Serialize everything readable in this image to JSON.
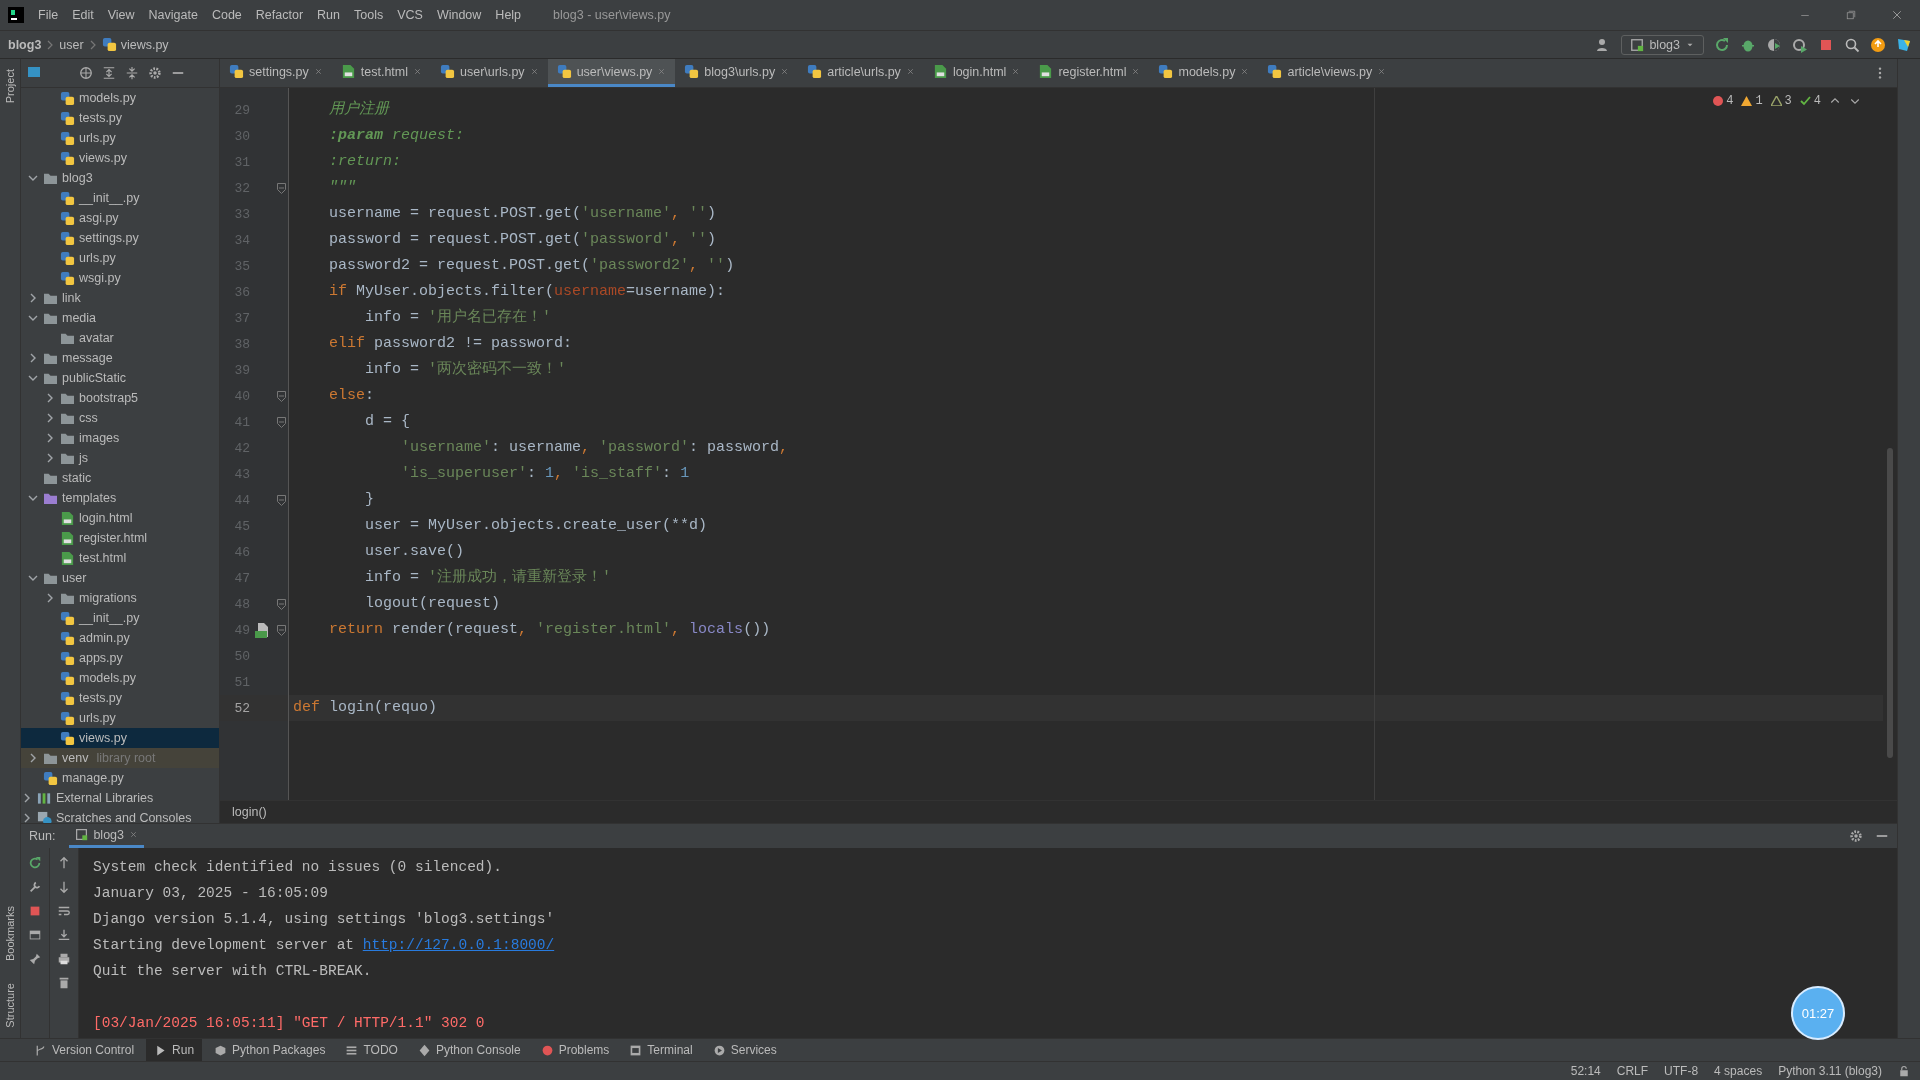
{
  "window": {
    "title": "blog3 - user\\views.py",
    "menu": [
      "File",
      "Edit",
      "View",
      "Navigate",
      "Code",
      "Refactor",
      "Run",
      "Tools",
      "VCS",
      "Window",
      "Help"
    ]
  },
  "breadcrumbs": [
    "blog3",
    "user",
    "views.py"
  ],
  "run_config": {
    "label": "blog3"
  },
  "left_strip": {
    "top": [
      "Project"
    ],
    "bottom": [
      "Bookmarks",
      "Structure"
    ]
  },
  "project_tree": [
    {
      "children": [
        {
          "children": [
            {
              "label": "models.py",
              "kind": "py",
              "selected": false
            },
            {
              "label": "tests.py",
              "kind": "py",
              "selected": false
            },
            {
              "label": "urls.py",
              "kind": "py",
              "selected": false
            },
            {
              "label": "views.py",
              "kind": "py",
              "selected": false
            }
          ]
        },
        {
          "label": "blog3",
          "kind": "folder",
          "expanded": true,
          "selected": false,
          "children": [
            {
              "label": "__init__.py",
              "kind": "py",
              "selected": false
            },
            {
              "label": "asgi.py",
              "kind": "py",
              "selected": false
            },
            {
              "label": "settings.py",
              "kind": "py",
              "selected": false
            },
            {
              "label": "urls.py",
              "kind": "py",
              "selected": false
            },
            {
              "label": "wsgi.py",
              "kind": "py",
              "selected": false
            }
          ]
        },
        {
          "label": "link",
          "kind": "folder",
          "expanded": false,
          "selected": false
        },
        {
          "label": "media",
          "kind": "folder",
          "expanded": true,
          "selected": false,
          "children": [
            {
              "label": "avatar",
              "kind": "folder",
              "selected": false
            }
          ]
        },
        {
          "label": "message",
          "kind": "folder",
          "expanded": false,
          "selected": false
        },
        {
          "label": "publicStatic",
          "kind": "folder",
          "expanded": true,
          "selected": false,
          "children": [
            {
              "label": "bootstrap5",
              "kind": "folder",
              "expanded": false,
              "selected": false
            },
            {
              "label": "css",
              "kind": "folder",
              "expanded": false,
              "selected": false
            },
            {
              "label": "images",
              "kind": "folder",
              "expanded": false,
              "selected": false
            },
            {
              "label": "js",
              "kind": "folder",
              "expanded": false,
              "selected": false
            }
          ]
        },
        {
          "label": "static",
          "kind": "folder",
          "selected": false
        },
        {
          "label": "templates",
          "kind": "template-folder",
          "expanded": true,
          "selected": false,
          "children": [
            {
              "label": "login.html",
              "kind": "html",
              "selected": false
            },
            {
              "label": "register.html",
              "kind": "html",
              "selected": false
            },
            {
              "label": "test.html",
              "kind": "html",
              "selected": false
            }
          ]
        },
        {
          "label": "user",
          "kind": "folder",
          "expanded": true,
          "selected": false,
          "children": [
            {
              "label": "migrations",
              "kind": "folder",
              "expanded": false,
              "selected": false
            },
            {
              "label": "__init__.py",
              "kind": "py",
              "selected": false
            },
            {
              "label": "admin.py",
              "kind": "py",
              "selected": false
            },
            {
              "label": "apps.py",
              "kind": "py",
              "selected": false
            },
            {
              "label": "models.py",
              "kind": "py",
              "selected": false
            },
            {
              "label": "tests.py",
              "kind": "py",
              "selected": false
            },
            {
              "label": "urls.py",
              "kind": "py",
              "selected": false
            },
            {
              "label": "views.py",
              "kind": "py",
              "selected": true
            }
          ]
        },
        {
          "label": "venv",
          "note": "library root",
          "kind": "library-folder",
          "expanded": false,
          "selected": false
        },
        {
          "label": "manage.py",
          "kind": "py",
          "selected": false
        }
      ]
    },
    {
      "label": "External Libraries",
      "kind": "libraries",
      "expanded": false,
      "selected": false
    },
    {
      "label": "Scratches and Consoles",
      "kind": "scratches",
      "expanded": false,
      "selected": false
    }
  ],
  "editor_tabs": [
    {
      "label": "settings.py",
      "kind": "py",
      "selected": false
    },
    {
      "label": "test.html",
      "kind": "html",
      "selected": false
    },
    {
      "label": "user\\urls.py",
      "kind": "py",
      "selected": false
    },
    {
      "label": "user\\views.py",
      "kind": "py",
      "selected": true
    },
    {
      "label": "blog3\\urls.py",
      "kind": "py",
      "selected": false
    },
    {
      "label": "article\\urls.py",
      "kind": "py",
      "selected": false
    },
    {
      "label": "login.html",
      "kind": "html",
      "selected": false
    },
    {
      "label": "register.html",
      "kind": "html",
      "selected": false
    },
    {
      "label": "models.py",
      "kind": "py",
      "selected": false
    },
    {
      "label": "article\\views.py",
      "kind": "py",
      "selected": false
    }
  ],
  "inspections": [
    {
      "kind": "error",
      "count": "4"
    },
    {
      "kind": "warning",
      "count": "1"
    },
    {
      "kind": "weak",
      "count": "3"
    },
    {
      "kind": "typo",
      "count": "4"
    }
  ],
  "code_lines": [
    {
      "number": "29",
      "fold": false,
      "current": false,
      "gutter_icon": false,
      "tokens": [
        {
          "text": "    用户注册",
          "kind": "doc"
        }
      ]
    },
    {
      "number": "30",
      "fold": false,
      "current": false,
      "gutter_icon": false,
      "tokens": [
        {
          "text": "    :param",
          "kind": "doctag"
        },
        {
          "text": " request:",
          "kind": "doc"
        }
      ]
    },
    {
      "number": "31",
      "fold": false,
      "current": false,
      "gutter_icon": false,
      "tokens": [
        {
          "text": "    :return:",
          "kind": "doc"
        }
      ]
    },
    {
      "number": "32",
      "fold": true,
      "current": false,
      "gutter_icon": false,
      "tokens": [
        {
          "text": "    \"\"\"",
          "kind": "doc"
        }
      ]
    },
    {
      "number": "33",
      "fold": false,
      "current": false,
      "gutter_icon": false,
      "tokens": [
        {
          "text": "    username = request.POST.get(",
          "kind": "plain"
        },
        {
          "text": "'username'",
          "kind": "str"
        },
        {
          "text": ", ",
          "kind": "kw"
        },
        {
          "text": "''",
          "kind": "str"
        },
        {
          "text": ")",
          "kind": "plain"
        }
      ]
    },
    {
      "number": "34",
      "fold": false,
      "current": false,
      "gutter_icon": false,
      "tokens": [
        {
          "text": "    password = request.POST.get(",
          "kind": "plain"
        },
        {
          "text": "'password'",
          "kind": "str"
        },
        {
          "text": ", ",
          "kind": "kw"
        },
        {
          "text": "''",
          "kind": "str"
        },
        {
          "text": ")",
          "kind": "plain"
        }
      ]
    },
    {
      "number": "35",
      "fold": false,
      "current": false,
      "gutter_icon": false,
      "tokens": [
        {
          "text": "    password2 = request.POST.get(",
          "kind": "plain"
        },
        {
          "text": "'password2'",
          "kind": "str"
        },
        {
          "text": ", ",
          "kind": "kw"
        },
        {
          "text": "''",
          "kind": "str"
        },
        {
          "text": ")",
          "kind": "plain"
        }
      ]
    },
    {
      "number": "36",
      "fold": false,
      "current": false,
      "gutter_icon": false,
      "tokens": [
        {
          "text": "    if",
          "kind": "kw"
        },
        {
          "text": " MyUser.objects.filter(",
          "kind": "plain"
        },
        {
          "text": "username",
          "kind": "param"
        },
        {
          "text": "=username):",
          "kind": "plain"
        }
      ]
    },
    {
      "number": "37",
      "fold": false,
      "current": false,
      "gutter_icon": false,
      "tokens": [
        {
          "text": "        info = ",
          "kind": "plain"
        },
        {
          "text": "'用户名已存在！'",
          "kind": "str"
        }
      ]
    },
    {
      "number": "38",
      "fold": false,
      "current": false,
      "gutter_icon": false,
      "tokens": [
        {
          "text": "    elif",
          "kind": "kw"
        },
        {
          "text": " password2 != password:",
          "kind": "plain"
        }
      ]
    },
    {
      "number": "39",
      "fold": false,
      "current": false,
      "gutter_icon": false,
      "tokens": [
        {
          "text": "        info = ",
          "kind": "plain"
        },
        {
          "text": "'两次密码不一致！'",
          "kind": "str"
        }
      ]
    },
    {
      "number": "40",
      "fold": true,
      "current": false,
      "gutter_icon": false,
      "tokens": [
        {
          "text": "    else",
          "kind": "kw"
        },
        {
          "text": ":",
          "kind": "plain"
        }
      ]
    },
    {
      "number": "41",
      "fold": true,
      "current": false,
      "gutter_icon": false,
      "tokens": [
        {
          "text": "        d = {",
          "kind": "plain"
        }
      ]
    },
    {
      "number": "42",
      "fold": false,
      "current": false,
      "gutter_icon": false,
      "tokens": [
        {
          "text": "            'username'",
          "kind": "str"
        },
        {
          "text": ": username",
          "kind": "plain"
        },
        {
          "text": ", ",
          "kind": "kw"
        },
        {
          "text": "'password'",
          "kind": "str"
        },
        {
          "text": ": password",
          "kind": "plain"
        },
        {
          "text": ",",
          "kind": "kw"
        }
      ]
    },
    {
      "number": "43",
      "fold": false,
      "current": false,
      "gutter_icon": false,
      "tokens": [
        {
          "text": "            'is_superuser'",
          "kind": "str"
        },
        {
          "text": ": ",
          "kind": "plain"
        },
        {
          "text": "1",
          "kind": "num"
        },
        {
          "text": ", ",
          "kind": "kw"
        },
        {
          "text": "'is_staff'",
          "kind": "str"
        },
        {
          "text": ": ",
          "kind": "plain"
        },
        {
          "text": "1",
          "kind": "num"
        }
      ]
    },
    {
      "number": "44",
      "fold": true,
      "current": false,
      "gutter_icon": false,
      "tokens": [
        {
          "text": "        }",
          "kind": "plain"
        }
      ]
    },
    {
      "number": "45",
      "fold": false,
      "current": false,
      "gutter_icon": false,
      "tokens": [
        {
          "text": "        user = MyUser.objects.create_user(**d)",
          "kind": "plain"
        }
      ]
    },
    {
      "number": "46",
      "fold": false,
      "current": false,
      "gutter_icon": false,
      "tokens": [
        {
          "text": "        user.save()",
          "kind": "plain"
        }
      ]
    },
    {
      "number": "47",
      "fold": false,
      "current": false,
      "gutter_icon": false,
      "tokens": [
        {
          "text": "        info = ",
          "kind": "plain"
        },
        {
          "text": "'注册成功，请重新登录！'",
          "kind": "str"
        }
      ]
    },
    {
      "number": "48",
      "fold": true,
      "current": false,
      "gutter_icon": false,
      "tokens": [
        {
          "text": "        logout(request)",
          "kind": "plain"
        }
      ]
    },
    {
      "number": "49",
      "fold": true,
      "current": false,
      "gutter_icon": true,
      "tokens": [
        {
          "text": "    return",
          "kind": "kw"
        },
        {
          "text": " render(request",
          "kind": "plain"
        },
        {
          "text": ", ",
          "kind": "kw"
        },
        {
          "text": "'register.html'",
          "kind": "str"
        },
        {
          "text": ", ",
          "kind": "kw"
        },
        {
          "text": "locals",
          "kind": "builtin"
        },
        {
          "text": "())",
          "kind": "plain"
        }
      ]
    },
    {
      "number": "50",
      "fold": false,
      "current": false,
      "gutter_icon": false
    },
    {
      "number": "51",
      "fold": false,
      "current": false,
      "gutter_icon": false
    },
    {
      "number": "52",
      "fold": false,
      "current": true,
      "gutter_icon": false,
      "tokens": [
        {
          "text": "def",
          "kind": "kw"
        },
        {
          "text": " login(requo)",
          "kind": "plain"
        }
      ]
    }
  ],
  "editor_breadcrumb": "login()",
  "run_panel": {
    "label": "Run:",
    "tab": "blog3",
    "console": [
      {
        "text": "System check identified no issues (0 silenced).",
        "kind": "output"
      },
      {
        "text": "January 03, 2025 - 16:05:09",
        "kind": "output"
      },
      {
        "text": "Django version 5.1.4, using settings 'blog3.settings'",
        "kind": "output"
      },
      {
        "text": "Starting development server at ",
        "link": "http://127.0.0.1:8000/",
        "kind": "output"
      },
      {
        "text": "Quit the server with CTRL-BREAK.",
        "kind": "output"
      },
      {
        "text": "[03/Jan/2025 16:05:11] \"GET / HTTP/1.1\" 302 0",
        "kind": "error"
      }
    ]
  },
  "tool_tabs": [
    {
      "label": "Version Control",
      "kind": "vcs",
      "selected": false
    },
    {
      "label": "Run",
      "kind": "run",
      "selected": true
    },
    {
      "label": "Python Packages",
      "kind": "packages",
      "selected": false
    },
    {
      "label": "TODO",
      "kind": "todo",
      "selected": false
    },
    {
      "label": "Python Console",
      "kind": "console",
      "selected": false
    },
    {
      "label": "Problems",
      "kind": "problems",
      "selected": false
    },
    {
      "label": "Terminal",
      "kind": "terminal",
      "selected": false
    },
    {
      "label": "Services",
      "kind": "services",
      "selected": false
    }
  ],
  "status_bar": [
    "52:14",
    "CRLF",
    "UTF-8",
    "4 spaces",
    "Python 3.11 (blog3)"
  ],
  "recorder_badge": {
    "time": "01:27"
  }
}
